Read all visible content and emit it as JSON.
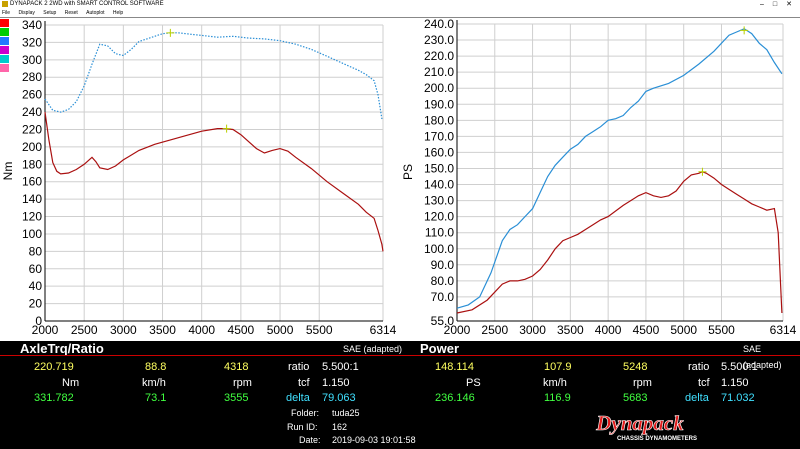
{
  "window": {
    "title": "DYNAPACK 2 2WD with SMART CONTROL SOFTWARE",
    "menu": [
      "File",
      "Display",
      "Setup",
      "Reset",
      "Autoplot",
      "Help"
    ]
  },
  "swatches": [
    "#ff0000",
    "#00cc00",
    "#2277ff",
    "#cc00cc",
    "#00cccc",
    "#ff66aa"
  ],
  "chart_data": [
    {
      "type": "line",
      "xlabel": "Engine RPM",
      "ylabel": "Nm",
      "x_ticks": [
        2000,
        2500,
        3000,
        3500,
        4000,
        4500,
        5000,
        5500,
        6314
      ],
      "xlim": [
        2000,
        6314
      ],
      "ylim": [
        0,
        340
      ],
      "y_ticks": [
        0,
        20,
        40,
        60,
        80,
        100,
        120,
        140,
        160,
        180,
        200,
        220,
        240,
        260,
        280,
        300,
        320,
        340
      ],
      "grid": true,
      "standard": "SAE (adapted)",
      "series": [
        {
          "color": "#2a8fd6",
          "style": "dotted",
          "x": [
            2000,
            2100,
            2200,
            2300,
            2400,
            2500,
            2600,
            2700,
            2800,
            2900,
            3000,
            3100,
            3200,
            3300,
            3400,
            3500,
            3600,
            3700,
            3800,
            3900,
            4000,
            4200,
            4400,
            4600,
            4800,
            5000,
            5200,
            5400,
            5600,
            5800,
            6000,
            6100,
            6200,
            6250,
            6300
          ],
          "y": [
            255,
            242,
            240,
            243,
            252,
            270,
            295,
            318,
            316,
            307,
            305,
            312,
            321,
            324,
            327,
            330,
            331,
            331,
            330,
            329,
            328,
            326,
            327,
            325,
            324,
            322,
            318,
            312,
            304,
            296,
            288,
            283,
            276,
            260,
            232
          ]
        },
        {
          "color": "#aa1010",
          "style": "solid",
          "x": [
            2000,
            2050,
            2100,
            2150,
            2200,
            2300,
            2400,
            2500,
            2600,
            2650,
            2700,
            2800,
            2900,
            3000,
            3200,
            3400,
            3600,
            3800,
            4000,
            4200,
            4300,
            4400,
            4500,
            4600,
            4700,
            4800,
            4900,
            5000,
            5100,
            5200,
            5400,
            5600,
            5800,
            6000,
            6100,
            6200,
            6250,
            6300,
            6314
          ],
          "y": [
            240,
            208,
            182,
            172,
            169,
            170,
            174,
            180,
            188,
            183,
            176,
            174,
            178,
            185,
            196,
            203,
            208,
            213,
            218,
            221,
            221,
            220,
            214,
            206,
            198,
            193,
            196,
            198,
            195,
            188,
            175,
            160,
            147,
            134,
            125,
            118,
            104,
            88,
            80
          ]
        }
      ],
      "markers": [
        {
          "x": 3600,
          "y": 331
        },
        {
          "x": 4318,
          "y": 221
        }
      ]
    },
    {
      "type": "line",
      "xlabel": "Engine RPM",
      "ylabel": "PS",
      "x_ticks": [
        2000,
        2500,
        3000,
        3500,
        4000,
        4500,
        5000,
        5500,
        6314
      ],
      "xlim": [
        2000,
        6314
      ],
      "ylim": [
        55,
        240
      ],
      "y_ticks": [
        55,
        70,
        80,
        90,
        100,
        110,
        120,
        130,
        140,
        150,
        160,
        170,
        180,
        190,
        200,
        210,
        220,
        230,
        240
      ],
      "grid": true,
      "standard": "SAE (adapted)",
      "series": [
        {
          "color": "#2a8fd6",
          "style": "solid",
          "x": [
            2000,
            2150,
            2300,
            2450,
            2600,
            2700,
            2800,
            2900,
            3000,
            3100,
            3200,
            3300,
            3400,
            3500,
            3600,
            3700,
            3800,
            3900,
            4000,
            4100,
            4200,
            4300,
            4400,
            4500,
            4600,
            4800,
            5000,
            5200,
            5400,
            5600,
            5700,
            5800,
            5900,
            6000,
            6100,
            6200,
            6300
          ],
          "y": [
            63,
            65,
            70,
            85,
            105,
            112,
            115,
            120,
            125,
            135,
            145,
            152,
            157,
            162,
            165,
            170,
            173,
            176,
            180,
            181,
            183,
            188,
            192,
            198,
            200,
            203,
            208,
            215,
            223,
            233,
            235,
            237,
            234,
            228,
            224,
            216,
            209
          ]
        },
        {
          "color": "#aa1010",
          "style": "solid",
          "x": [
            2000,
            2200,
            2400,
            2500,
            2600,
            2700,
            2800,
            2900,
            3000,
            3100,
            3200,
            3300,
            3400,
            3500,
            3600,
            3700,
            3800,
            3900,
            4000,
            4200,
            4400,
            4500,
            4600,
            4700,
            4800,
            4900,
            5000,
            5100,
            5200,
            5248,
            5300,
            5400,
            5500,
            5600,
            5700,
            5800,
            5900,
            6000,
            6100,
            6200,
            6250,
            6300
          ],
          "y": [
            60,
            62,
            68,
            73,
            78,
            80,
            80,
            81,
            83,
            87,
            93,
            100,
            105,
            107,
            109,
            112,
            115,
            118,
            120,
            127,
            133,
            135,
            133,
            132,
            133,
            136,
            142,
            146,
            147,
            148,
            147,
            144,
            140,
            137,
            134,
            131,
            128,
            126,
            124,
            125,
            110,
            60
          ]
        }
      ],
      "markers": [
        {
          "x": 5248,
          "y": 148
        },
        {
          "x": 5800,
          "y": 236
        }
      ]
    }
  ],
  "panels": {
    "left": {
      "title": "AxleTrq/Ratio",
      "current": {
        "torque": "220.719",
        "speed": "88.8",
        "rpm": "4318"
      },
      "units": {
        "torque": "Nm",
        "speed": "km/h",
        "rpm": "rpm"
      },
      "peak": {
        "torque": "331.782",
        "speed": "73.1",
        "rpm": "3555"
      },
      "ratio_label": "ratio",
      "ratio_value": "5.500:1",
      "tcf_label": "tcf",
      "tcf_value": "1.150",
      "delta_label": "delta",
      "delta_value": "79.063",
      "standard": "SAE (adapted)"
    },
    "right": {
      "title": "Power",
      "current": {
        "power": "148.114",
        "speed": "107.9",
        "rpm": "5248"
      },
      "units": {
        "power": "PS",
        "speed": "km/h",
        "rpm": "rpm"
      },
      "peak": {
        "power": "236.146",
        "speed": "116.9",
        "rpm": "5683"
      },
      "ratio_label": "ratio",
      "ratio_value": "5.500:1",
      "tcf_label": "tcf",
      "tcf_value": "1.150",
      "delta_label": "delta",
      "delta_value": "71.032",
      "standard": "SAE (adapted)"
    },
    "info": {
      "folder_label": "Folder:",
      "folder_value": "tuda25",
      "runid_label": "Run ID:",
      "runid_value": "162",
      "date_label": "Date:",
      "date_value": "2019-09-03 19:01:58"
    }
  },
  "logo": {
    "brand": "Dynapack",
    "tagline": "CHASSIS DYNAMOMETERS"
  }
}
